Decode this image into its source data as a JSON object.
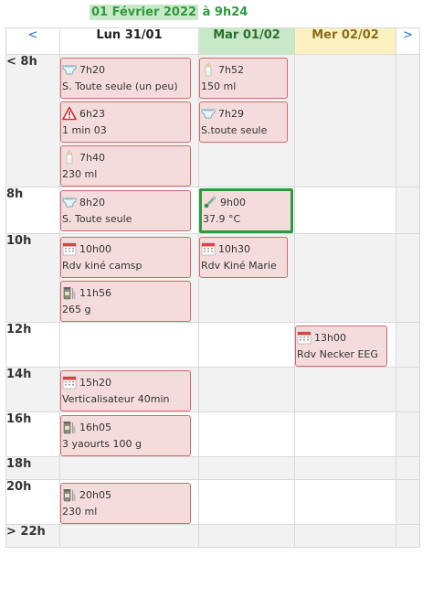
{
  "header": {
    "date": "01 Février 2022",
    "separator": "à",
    "time": "9h24"
  },
  "nav": {
    "prev": "<",
    "next": ">"
  },
  "days": {
    "lun": "Lun 31/01",
    "mar": "Mar 01/02",
    "mer": "Mer 02/02"
  },
  "hours": {
    "before8": "< 8h",
    "h8": "8h",
    "h10": "10h",
    "h12": "12h",
    "h14": "14h",
    "h16": "16h",
    "h18": "18h",
    "h20": "20h",
    "after22": "> 22h"
  },
  "events": {
    "lun_before8_1": {
      "icon": "diaper-icon",
      "time": "7h20",
      "label": "S. Toute seule (un peu)"
    },
    "lun_before8_2": {
      "icon": "warning-icon",
      "time": "6h23",
      "label": "1 min 03"
    },
    "lun_before8_3": {
      "icon": "baby-bottle-icon",
      "time": "7h40",
      "label": "230 ml"
    },
    "mar_before8_1": {
      "icon": "baby-bottle-icon",
      "time": "7h52",
      "label": "150 ml"
    },
    "mar_before8_2": {
      "icon": "diaper-icon",
      "time": "7h29",
      "label": "S.toute seule"
    },
    "lun_8_1": {
      "icon": "diaper-icon",
      "time": "8h20",
      "label": "S. Toute seule"
    },
    "mar_8_1": {
      "icon": "thermometer-icon",
      "time": "9h00",
      "label": "37.9 °C"
    },
    "lun_10_1": {
      "icon": "calendar-icon",
      "time": "10h00",
      "label": "Rdv kiné camsp"
    },
    "lun_10_2": {
      "icon": "food-jar-icon",
      "time": "11h56",
      "label": "265 g"
    },
    "mar_10_1": {
      "icon": "calendar-icon",
      "time": "10h30",
      "label": "Rdv Kiné Marie"
    },
    "mer_12_1": {
      "icon": "calendar-icon",
      "time": "13h00",
      "label": "Rdv Necker EEG"
    },
    "lun_14_1": {
      "icon": "calendar-icon",
      "time": "15h20",
      "label": "Verticalisateur 40min"
    },
    "lun_16_1": {
      "icon": "food-jar-icon",
      "time": "16h05",
      "label": "3 yaourts 100 g"
    },
    "lun_20_1": {
      "icon": "food-jar-icon",
      "time": "20h05",
      "label": "230 ml"
    }
  },
  "colors": {
    "accent_green": "#2e9a3c",
    "event_bg": "#f4dcdc",
    "event_border": "#d16a6a",
    "today_header": "#c8e9c7",
    "tomorrow_header": "#fdf1c2",
    "nav_blue": "#1f6fd0"
  }
}
